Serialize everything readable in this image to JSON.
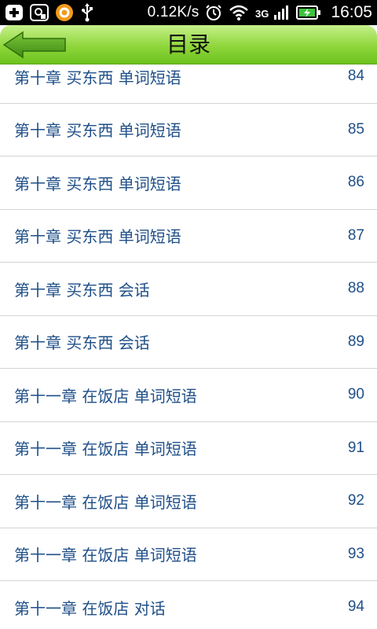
{
  "status_bar": {
    "network_speed": "0.12K/s",
    "network_type": "3G",
    "time": "16:05",
    "icons": [
      "add-notification-icon",
      "app-notification-icon",
      "weibo-notification-icon",
      "usb-icon",
      "alarm-icon",
      "wifi-icon",
      "signal-icon",
      "battery-charging-icon"
    ]
  },
  "header": {
    "title": "目录",
    "back_icon": "back-arrow-icon",
    "colors": {
      "bar_top": "#c6f08a",
      "bar_bottom": "#6cc21e",
      "arrow": "#4f9a1a"
    }
  },
  "list": {
    "text_color": "#1f4f88",
    "divider_color": "#d4d4d4",
    "items": [
      {
        "title": "第十章  买东西  单词短语",
        "page": "84"
      },
      {
        "title": "第十章  买东西  单词短语",
        "page": "85"
      },
      {
        "title": "第十章  买东西  单词短语",
        "page": "86"
      },
      {
        "title": "第十章  买东西  单词短语",
        "page": "87"
      },
      {
        "title": "第十章  买东西  会话",
        "page": "88"
      },
      {
        "title": "第十章  买东西  会话",
        "page": "89"
      },
      {
        "title": "第十一章  在饭店  单词短语",
        "page": "90"
      },
      {
        "title": "第十一章  在饭店  单词短语",
        "page": "91"
      },
      {
        "title": "第十一章  在饭店  单词短语",
        "page": "92"
      },
      {
        "title": "第十一章  在饭店  单词短语",
        "page": "93"
      },
      {
        "title": "第十一章  在饭店  对话",
        "page": "94"
      }
    ]
  }
}
